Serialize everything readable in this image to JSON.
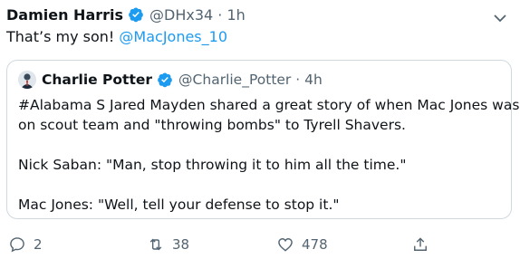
{
  "tweet": {
    "author_name": "Damien Harris",
    "handle_time": "@DHx34 · 1h",
    "text_prefix": "That’s my son! ",
    "mention": "@MacJones_10"
  },
  "quote": {
    "author_name": "Charlie Potter",
    "handle_time": "@Charlie_Potter · 4h",
    "line1": "#Alabama S Jared Mayden shared a great story of when Mac Jones was",
    "line2": "on scout team and \"throwing bombs\" to Tyrell Shavers.",
    "line3": "Nick Saban: \"Man, stop throwing it to him all the time.\"",
    "line4": "Mac Jones: \"Well, tell your defense to stop it.\""
  },
  "actions": {
    "replies": "2",
    "retweets": "38",
    "likes": "478"
  },
  "colors": {
    "accent": "#1d9bf0",
    "muted": "#536471",
    "border": "#cfd9de"
  }
}
